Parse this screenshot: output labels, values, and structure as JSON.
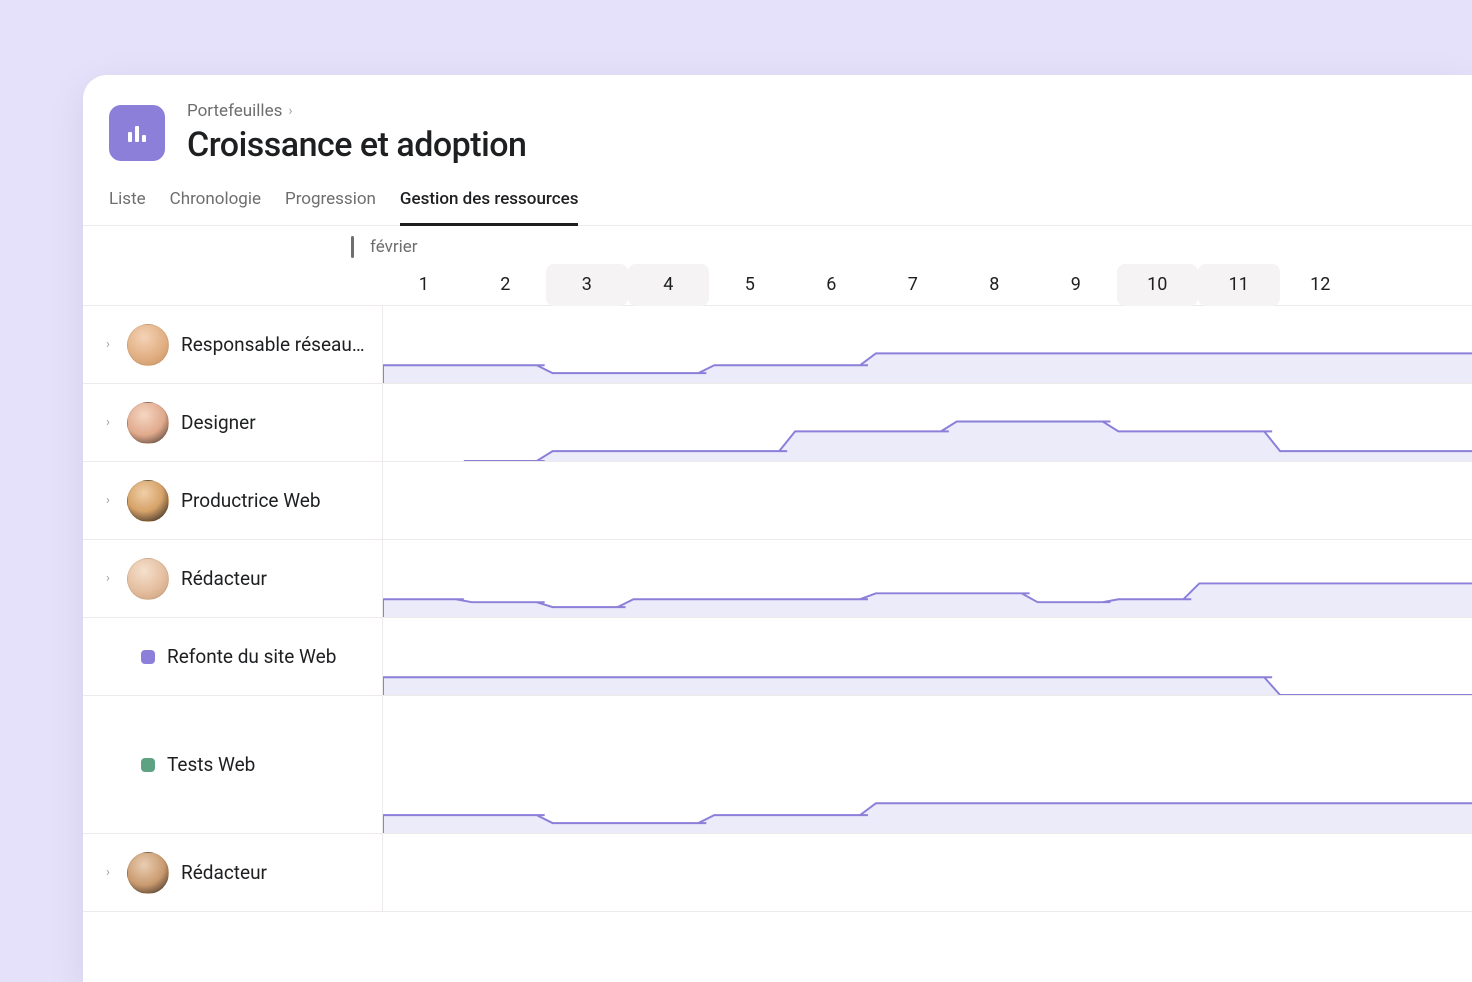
{
  "breadcrumb": {
    "root": "Portefeuilles"
  },
  "page_title": "Croissance et adoption",
  "tabs": [
    {
      "id": "liste",
      "label": "Liste",
      "active": false
    },
    {
      "id": "chrono",
      "label": "Chronologie",
      "active": false
    },
    {
      "id": "prog",
      "label": "Progression",
      "active": false
    },
    {
      "id": "resources",
      "label": "Gestion des ressources",
      "active": true
    }
  ],
  "timeline": {
    "month_label": "février",
    "days": [
      1,
      2,
      3,
      4,
      5,
      6,
      7,
      8,
      9,
      10,
      11,
      12
    ],
    "highlighted_ranges": [
      [
        3,
        4
      ],
      [
        10,
        11
      ]
    ]
  },
  "rows": [
    {
      "type": "person",
      "avatar": "a1",
      "label": "Responsable réseaux…",
      "expandable": true
    },
    {
      "type": "person",
      "avatar": "a2",
      "label": "Designer",
      "expandable": true
    },
    {
      "type": "person",
      "avatar": "a3",
      "label": "Productrice Web",
      "expandable": true
    },
    {
      "type": "person",
      "avatar": "a4",
      "label": "Rédacteur",
      "expandable": true
    },
    {
      "type": "project",
      "dot": "purple",
      "label": "Refonte du site Web"
    },
    {
      "type": "project",
      "dot": "teal",
      "label": "Tests Web",
      "tall": true
    },
    {
      "type": "person",
      "avatar": "a5",
      "label": "Rédacteur",
      "expandable": true
    }
  ],
  "chart_data": [
    {
      "type": "area",
      "row": "Responsable réseaux…",
      "x": [
        1,
        2,
        3,
        4,
        5,
        6,
        7,
        8,
        9,
        10,
        11,
        12
      ],
      "values": [
        18,
        18,
        10,
        10,
        18,
        18,
        30,
        30,
        30,
        30,
        30,
        30
      ],
      "ylim": [
        0,
        78
      ]
    },
    {
      "type": "area",
      "row": "Designer",
      "x": [
        1,
        2,
        3,
        4,
        5,
        6,
        7,
        8,
        9,
        10,
        11,
        12
      ],
      "values": [
        0,
        0,
        10,
        10,
        10,
        30,
        30,
        40,
        40,
        30,
        30,
        10
      ],
      "ylim": [
        0,
        78
      ],
      "start_at": 2
    },
    {
      "type": "area",
      "row": "Productrice Web",
      "x": [
        1,
        2,
        3,
        4,
        5,
        6,
        7,
        8,
        9,
        10,
        11,
        12
      ],
      "values": [
        0,
        0,
        0,
        0,
        0,
        0,
        0,
        0,
        0,
        0,
        0,
        0
      ],
      "ylim": [
        0,
        78
      ]
    },
    {
      "type": "area",
      "row": "Rédacteur",
      "x": [
        1,
        2,
        3,
        4,
        5,
        6,
        7,
        8,
        9,
        10,
        11,
        12
      ],
      "values": [
        18,
        15,
        10,
        18,
        18,
        18,
        24,
        24,
        15,
        18,
        34,
        34
      ],
      "ylim": [
        0,
        78
      ]
    },
    {
      "type": "area",
      "row": "Refonte du site Web",
      "x": [
        1,
        2,
        3,
        4,
        5,
        6,
        7,
        8,
        9,
        10,
        11,
        12
      ],
      "values": [
        18,
        18,
        18,
        18,
        18,
        18,
        18,
        18,
        18,
        18,
        18,
        0
      ],
      "ylim": [
        0,
        78
      ]
    },
    {
      "type": "area",
      "row": "Tests Web",
      "x": [
        1,
        2,
        3,
        4,
        5,
        6,
        7,
        8,
        9,
        10,
        11,
        12
      ],
      "values": [
        18,
        18,
        10,
        10,
        18,
        18,
        30,
        30,
        30,
        30,
        30,
        30
      ],
      "ylim": [
        0,
        138
      ]
    },
    {
      "type": "area",
      "row": "Rédacteur (2)",
      "x": [
        1,
        2,
        3,
        4,
        5,
        6,
        7,
        8,
        9,
        10,
        11,
        12
      ],
      "values": [
        0,
        0,
        0,
        0,
        0,
        0,
        0,
        0,
        0,
        0,
        0,
        0
      ],
      "ylim": [
        0,
        78
      ]
    }
  ]
}
